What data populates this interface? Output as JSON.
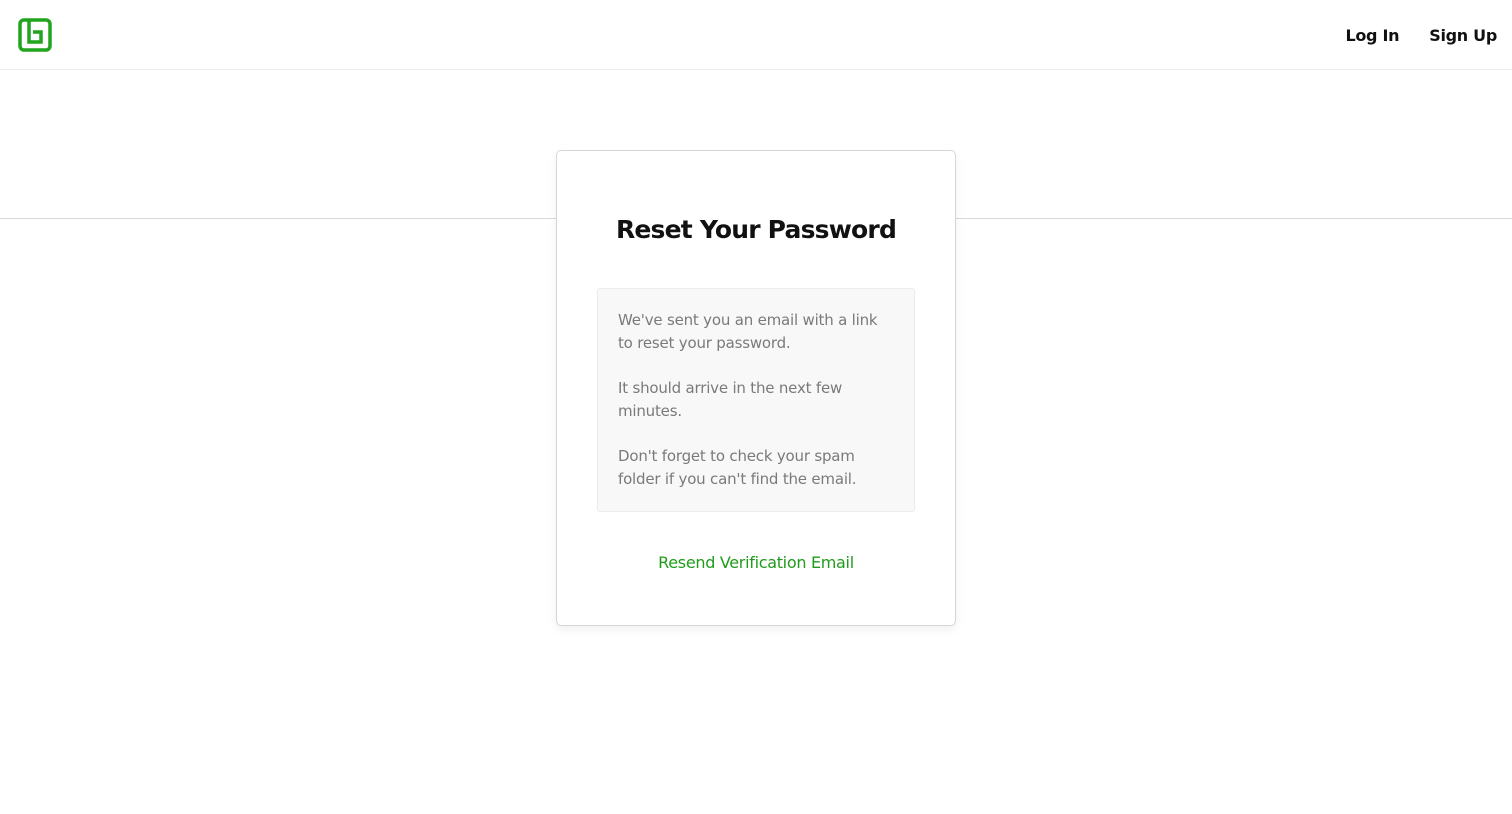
{
  "header": {
    "logo_icon": "brand-logo-icon",
    "brand_color": "#21a41e",
    "nav": {
      "login_label": "Log In",
      "signup_label": "Sign Up"
    }
  },
  "card": {
    "title": "Reset Your Password",
    "messages": [
      "We've sent you an email with a link to reset your password.",
      "It should arrive in the next few minutes.",
      "Don't forget to check your spam folder if you can't find the email."
    ],
    "resend_label": "Resend Verification Email",
    "link_color": "#1f9c1a"
  }
}
